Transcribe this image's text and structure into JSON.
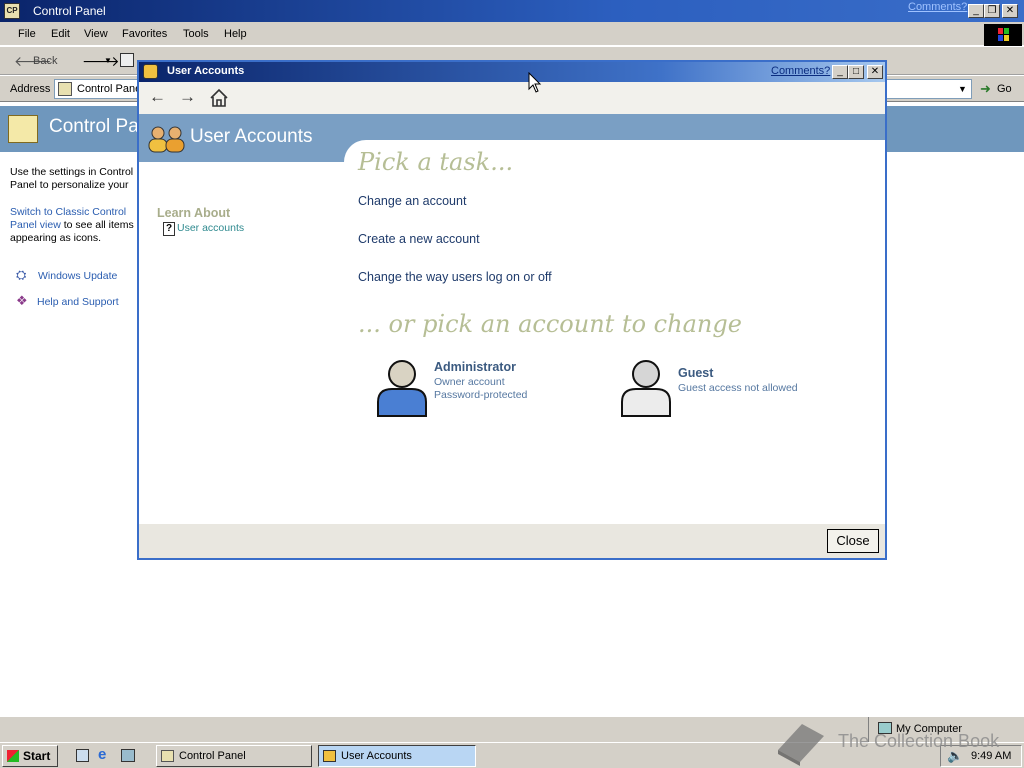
{
  "control_panel": {
    "title": "Control Panel",
    "comments_link": "Comments?",
    "menu": [
      "File",
      "Edit",
      "View",
      "Favorites",
      "Tools",
      "Help"
    ],
    "toolbar": {
      "back_label": "Back"
    },
    "address": {
      "label": "Address",
      "value": "Control Panel",
      "go_label": "Go"
    },
    "banner_title": "Control Panel",
    "left_panel": {
      "intro": "Use the settings in Control Panel to personalize your computer.",
      "switch_link": "Switch to Classic Control Panel view",
      "switch_rest": "to see all items appearing as icons.",
      "see_also": [
        {
          "label": "Windows Update",
          "icon": "windows-update-icon"
        },
        {
          "label": "Help and Support",
          "icon": "help-book-icon"
        }
      ]
    }
  },
  "dialog": {
    "title": "User Accounts",
    "comments_link": "Comments?",
    "banner_title": "User Accounts",
    "learn_about": {
      "heading": "Learn About",
      "link": "User accounts"
    },
    "pick_task_heading": "Pick a task...",
    "tasks": [
      "Change an account",
      "Create a new account",
      "Change the way users log on or off"
    ],
    "pick_account_heading": "... or pick an account to change",
    "accounts": [
      {
        "name": "Administrator",
        "details": [
          "Owner account",
          "Password-protected"
        ],
        "color": "#4a7fd3"
      },
      {
        "name": "Guest",
        "details": [
          "Guest access not allowed"
        ],
        "color": "#e8e8e8"
      }
    ],
    "close_label": "Close"
  },
  "status_bar": {
    "location": "My Computer"
  },
  "taskbar": {
    "start_label": "Start",
    "buttons": [
      "Control Panel",
      "User Accounts"
    ],
    "clock": "9:49 AM"
  },
  "watermark": "The Collection Book",
  "colors": {
    "accent": "#3a6ec9",
    "banner": "#7a9fc4",
    "heading_pick": "#b6be95"
  }
}
